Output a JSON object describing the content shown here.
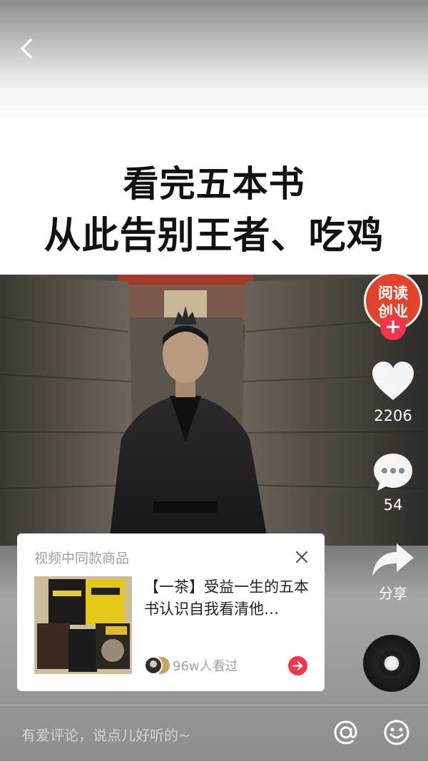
{
  "post": {
    "headline_line1": "看完五本书",
    "headline_line2": "从此告别王者、吃鸡"
  },
  "author": {
    "avatar_text_1": "阅读",
    "avatar_text_2": "创业",
    "follow_symbol": "+"
  },
  "actions": {
    "like_count": "2206",
    "comment_count": "54",
    "share_label": "分享"
  },
  "product_card": {
    "header": "视频中同款商品",
    "title": "【一茶】受益一生的五本书认识自我看清他…",
    "viewers": "96w人看过"
  },
  "comment_bar": {
    "placeholder": "有爱评论，说点儿好听的~"
  },
  "colors": {
    "accent": "#f2344c",
    "avatar_bg": "#e0442f"
  },
  "icons": [
    "back-icon",
    "heart-icon",
    "comment-icon",
    "share-icon",
    "close-icon",
    "arrow-right-icon",
    "at-icon",
    "emoji-icon",
    "music-disc-icon"
  ]
}
